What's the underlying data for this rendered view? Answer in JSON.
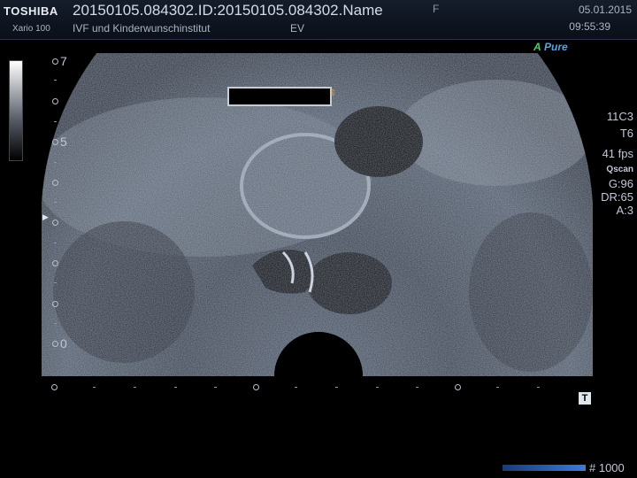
{
  "header": {
    "brand": "TOSHIBA",
    "model": "Xario 100",
    "study": "20150105.084302.ID:20150105.084302.Name",
    "institution": "IVF und Kinderwunschinstitut",
    "probe_mode": "EV",
    "sex": "F",
    "date": "05.01.2015",
    "time": "09:55:39"
  },
  "apure": {
    "prefix": "A",
    "label": "Pure"
  },
  "params": {
    "transducer": "11C3",
    "preset": "T6",
    "fps": "41 fps",
    "qscan": "Qscan",
    "gain": "G:96",
    "dynamic_range": "DR:65",
    "averaging": "A:3"
  },
  "depth_scale": {
    "top": "7",
    "mid": "5",
    "bottom": "0"
  },
  "footer": {
    "frames": "# 1000",
    "t_marker": "T"
  },
  "colors": {
    "accent": "#5ba3e0",
    "apure_green": "#49d06a",
    "caliper": "#d79a2a"
  }
}
